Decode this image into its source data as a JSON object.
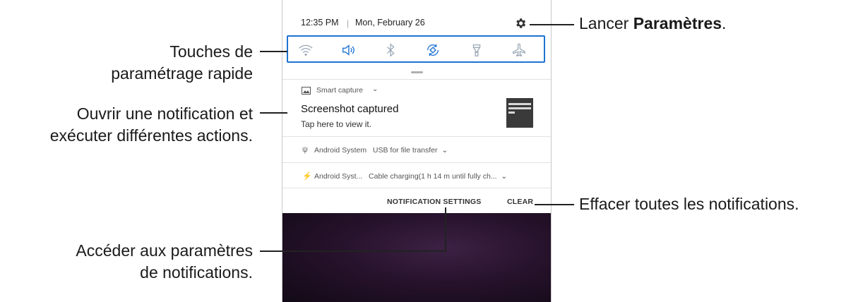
{
  "status_bar": {
    "time": "12:35 PM",
    "separator": "|",
    "date": "Mon, February 26"
  },
  "quick_settings": {
    "icons": [
      "wifi-icon",
      "sound-icon",
      "bluetooth-icon",
      "auto-rotate-icon",
      "flashlight-icon",
      "airplane-mode-icon"
    ],
    "active_color": "#1e73d4",
    "inactive_color": "#9aa7b5"
  },
  "notifications": {
    "smart_capture": {
      "app_label": "Smart capture",
      "title": "Screenshot captured",
      "subtitle": "Tap here to view it."
    },
    "android_usb": {
      "app": "Android System",
      "text": "USB for file transfer"
    },
    "android_charging": {
      "app": "Android Syst...",
      "text": "Cable charging(1 h 14 m until fully ch..."
    }
  },
  "buttons": {
    "notification_settings": "NOTIFICATION SETTINGS",
    "clear": "CLEAR"
  },
  "annotations": {
    "quick_settings": [
      "Touches de",
      "paramétrage rapide"
    ],
    "open_notification": [
      "Ouvrir une notification et",
      "exécuter différentes actions."
    ],
    "settings_prefix": "Lancer ",
    "settings_bold": "Paramètres",
    "settings_suffix": ".",
    "clear_all": "Effacer toutes les notifications.",
    "notification_settings": [
      "Accéder aux paramètres",
      "de notifications."
    ]
  },
  "colors": {
    "accent": "#1e73d4",
    "wallpaper": "#27122c"
  }
}
